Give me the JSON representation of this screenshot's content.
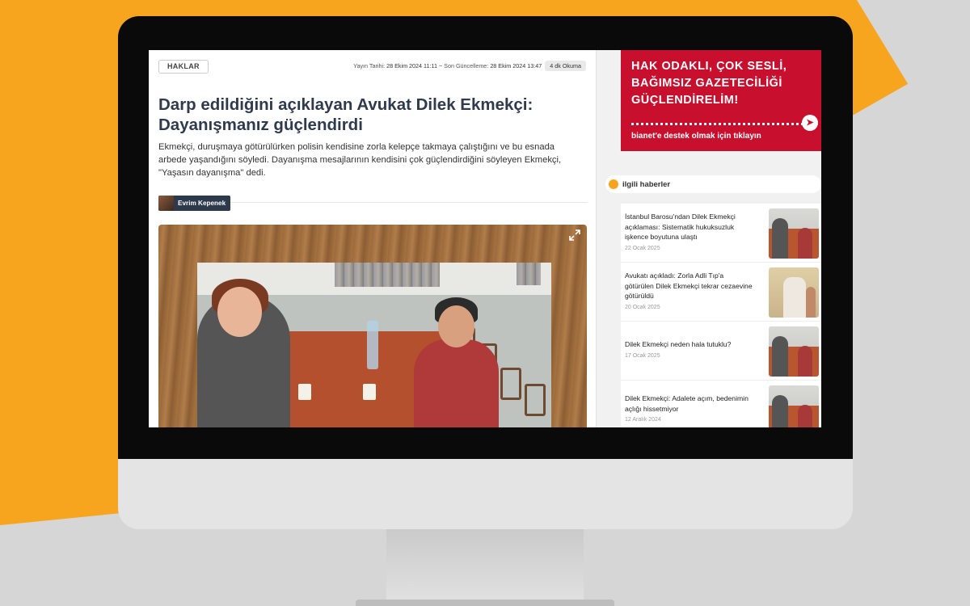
{
  "colors": {
    "background_orange": "#f7a51e",
    "background_grey": "#d6d6d6",
    "promo_red": "#c8102e",
    "title_navy": "#2f3a4c"
  },
  "article": {
    "category": "HAKLAR",
    "published_label": "Yayın Tarihi:",
    "published_value": "28 Ekim 2024 11:11",
    "separator": "~",
    "updated_label": "Son Güncelleme:",
    "updated_value": "28 Ekim 2024 13:47",
    "read_time": "4 dk Okuma",
    "title": "Darp edildiğini açıklayan Avukat Dilek Ekmekçi: Dayanışmanız güçlendirdi",
    "lead": "Ekmekçi, duruşmaya götürülürken polisin kendisine zorla kelepçe takmaya çalıştığını ve bu esnada arbede yaşandığını söyledi. Dayanışma mesajlarının kendisini çok güçlendirdiğini söyleyen Ekmekçi, \"Yaşasın dayanışma\" dedi.",
    "author": "Evrim Kepenek",
    "expand_icon": "expand-icon"
  },
  "promo": {
    "text": "HAK ODAKLI, ÇOK SESLİ, BAĞIMSIZ GAZETECİLİĞİ GÜÇLENDİRELİM!",
    "link": "bianet'e destek olmak için tıklayın",
    "cursor_icon": "cursor-click-icon"
  },
  "related": {
    "heading": "ilgili haberler",
    "items": [
      {
        "title": "İstanbul Barosu'ndan Dilek Ekmekçi açıklaması: Sistematik hukuksuzluk işkence boyutuna ulaştı",
        "date": "22 Ocak 2025"
      },
      {
        "title": "Avukatı açıkladı: Zorla Adli Tıp'a götürülen Dilek Ekmekçi tekrar cezaevine götürüldü",
        "date": "20 Ocak 2025"
      },
      {
        "title": "Dilek Ekmekçi neden hala tutuklu?",
        "date": "17 Ocak 2025"
      },
      {
        "title": "Dilek Ekmekçi: Adalete açım, bedenimin açlığı hissetmiyor",
        "date": "12 Aralık 2024"
      }
    ]
  }
}
